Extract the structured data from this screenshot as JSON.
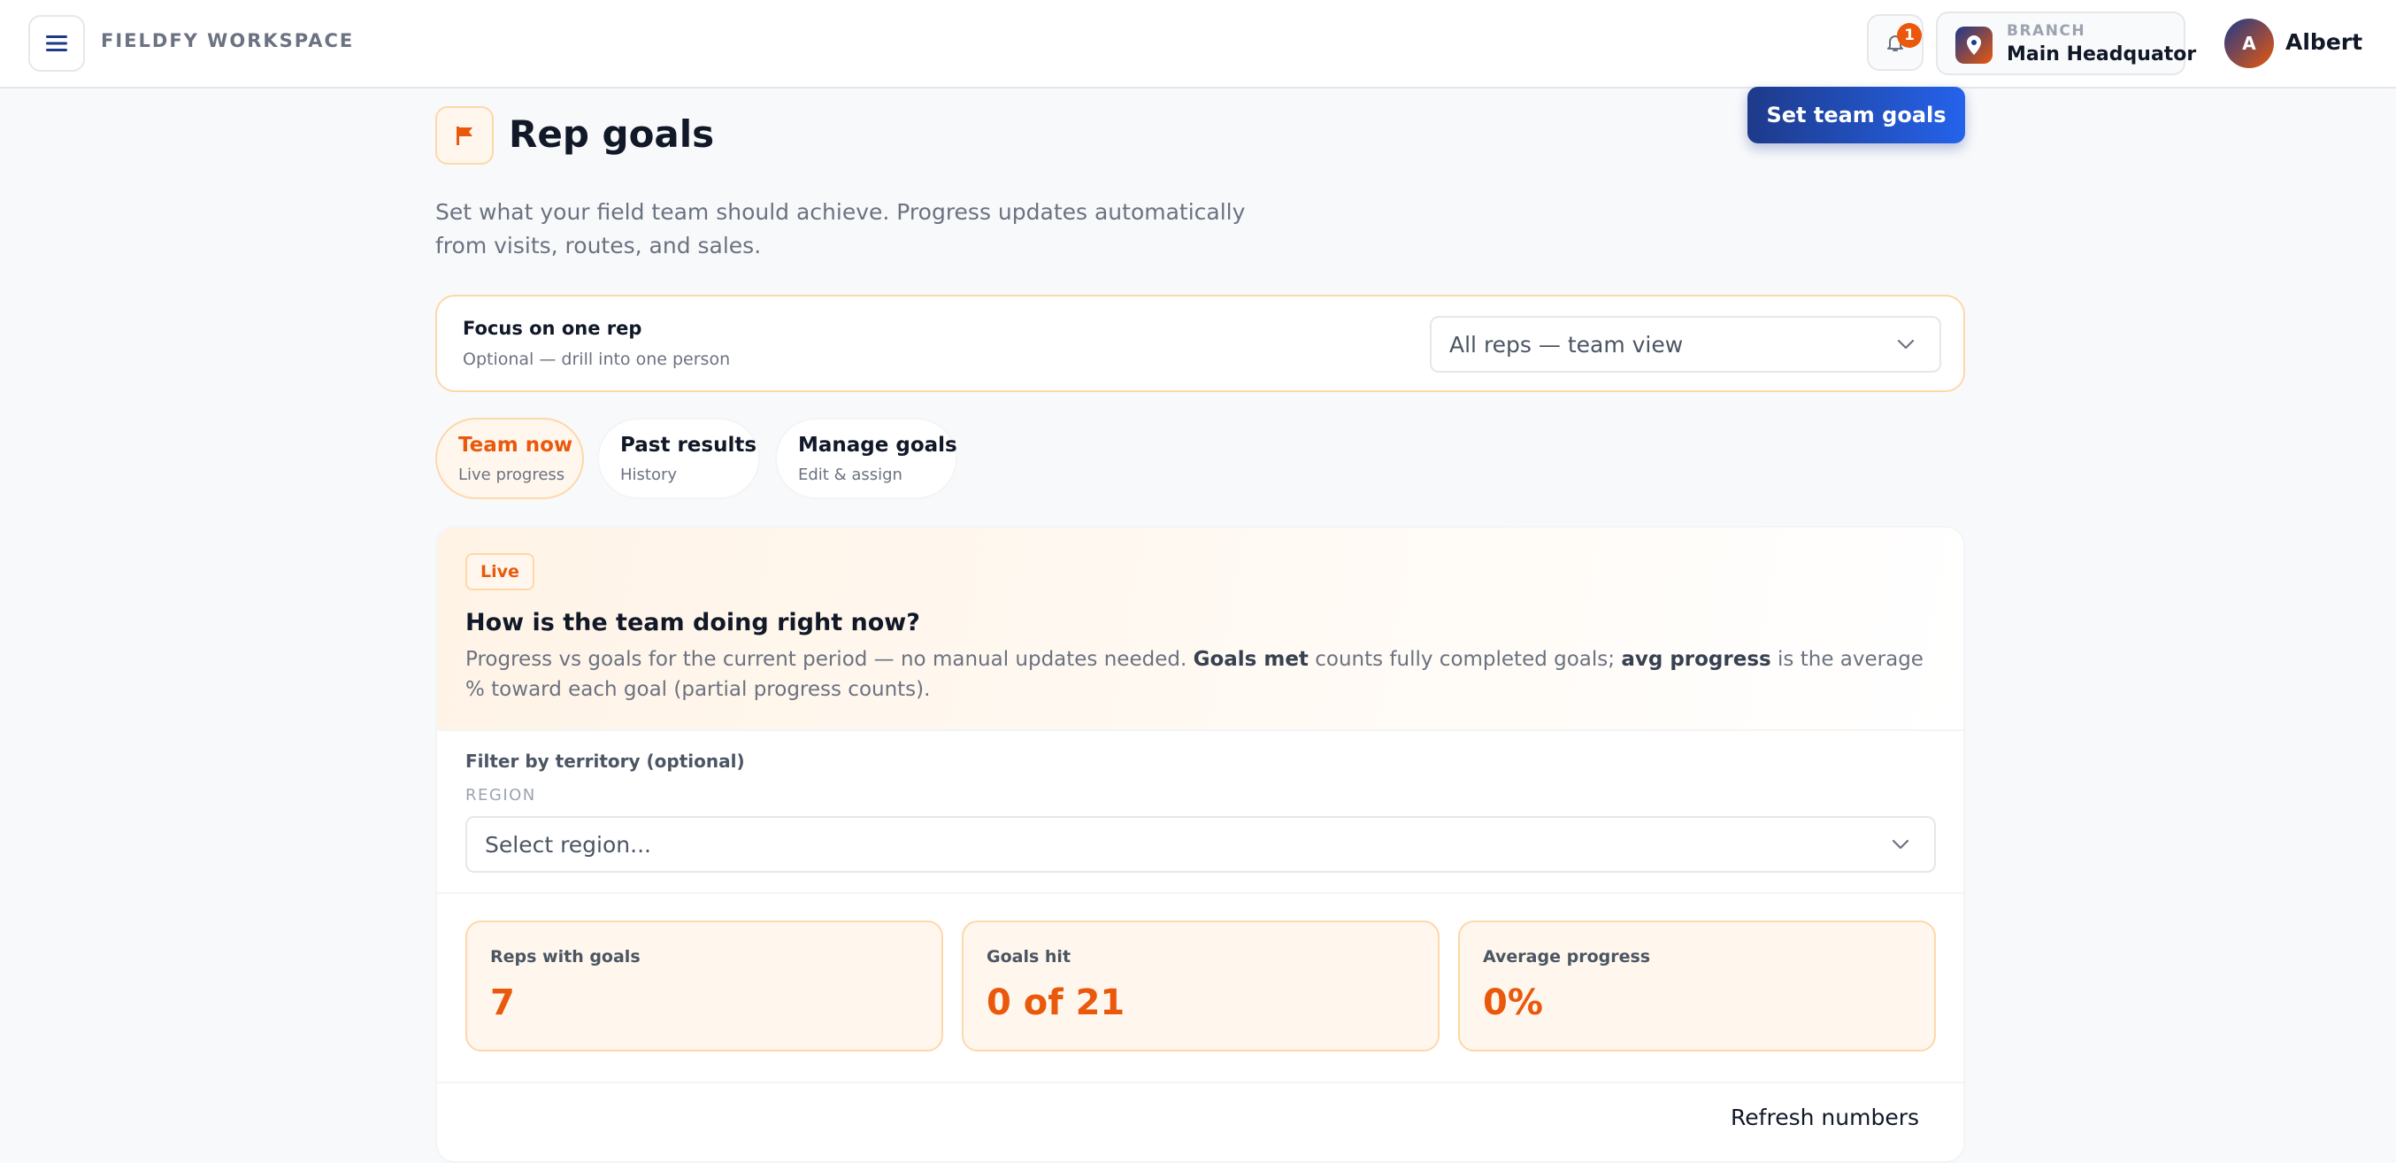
{
  "topbar": {
    "brand": "FIELDFY WORKSPACE",
    "notification_count": "1",
    "branch_label": "BRANCH",
    "branch_name": "Main Headquator",
    "avatar_initial": "A",
    "user_name": "Albert"
  },
  "header": {
    "title": "Rep goals",
    "primary_action": "Set team goals",
    "intro": "Set what your field team should achieve. Progress updates automatically from visits, routes, and sales."
  },
  "focus": {
    "title": "Focus on one rep",
    "subtitle": "Optional — drill into one person",
    "selected": "All reps — team view"
  },
  "tabs": [
    {
      "label": "Team now",
      "sub": "Live progress"
    },
    {
      "label": "Past results",
      "sub": "History"
    },
    {
      "label": "Manage goals",
      "sub": "Edit & assign"
    }
  ],
  "panel": {
    "badge": "Live",
    "title": "How is the team doing right now?",
    "desc_part1": "Progress vs goals for the current period — no manual updates needed. ",
    "desc_bold1": "Goals met",
    "desc_part2": " counts fully completed goals; ",
    "desc_bold2": "avg progress",
    "desc_part3": " is the average % toward each goal (partial progress counts).",
    "filter_label": "Filter by territory (optional)",
    "region_label": "REGION",
    "region_placeholder": "Select region...",
    "stats": [
      {
        "label": "Reps with goals",
        "value": "7"
      },
      {
        "label": "Goals hit",
        "value": "0 of 21"
      },
      {
        "label": "Average progress",
        "value": "0%"
      }
    ],
    "refresh_label": "Refresh numbers"
  },
  "colors": {
    "accent": "#ea580c",
    "primary": "#1e3a8a",
    "primary_light": "#2563eb"
  }
}
